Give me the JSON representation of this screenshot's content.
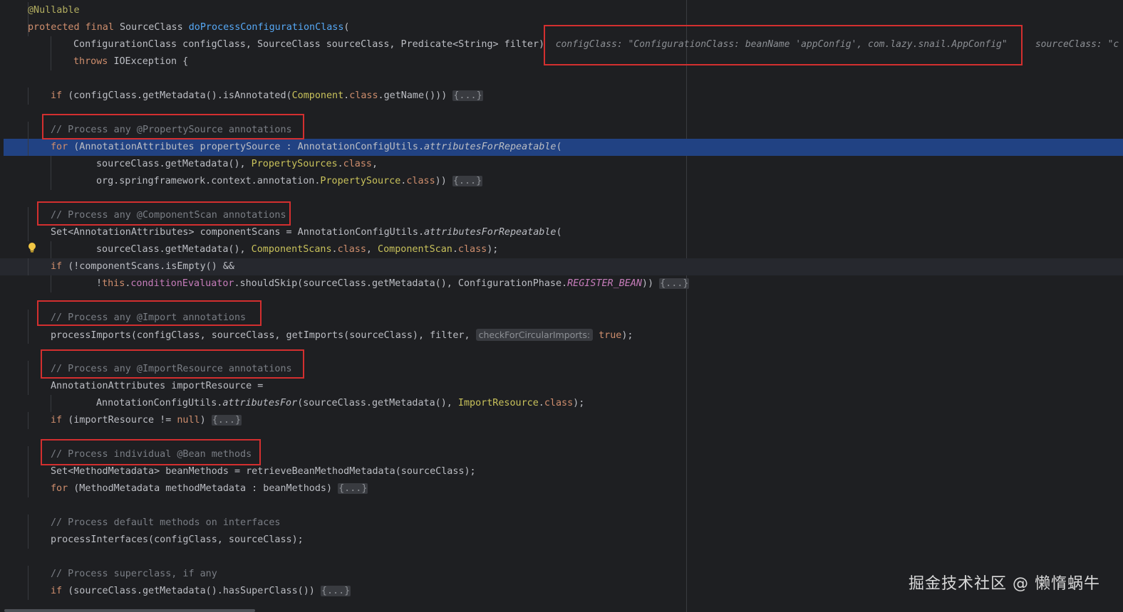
{
  "watermark": "掘金技术社区 @ 懒惰蜗牛",
  "icons": {
    "intention_bulb": "lightbulb-icon"
  },
  "colors": {
    "background": "#1e1f22",
    "keyword": "#cf8e6d",
    "method_declaration": "#56a8f5",
    "annotation": "#b3ae60",
    "class_ref": "#c9c25b",
    "comment": "#7a7e85",
    "field": "#c77dbb",
    "execution_line": "#214283",
    "highlight_box": "#d32f2f"
  },
  "lines": [
    {
      "tokens": [
        {
          "t": "@Nullable",
          "c": "ann"
        }
      ]
    },
    {
      "tokens": [
        {
          "t": "protected final ",
          "c": "kw"
        },
        {
          "t": "SourceClass ",
          "c": "plain"
        },
        {
          "t": "doProcessConfigurationClass",
          "c": "fn"
        },
        {
          "t": "(",
          "c": "plain"
        }
      ]
    },
    {
      "tokens": [
        {
          "t": "ConfigurationClass configClass, SourceClass sourceClass, Predicate<String> filter)",
          "c": "plain"
        },
        {
          "t": "  configClass: \"ConfigurationClass: beanName 'appConfig', com.lazy.snail.AppConfig\"     sourceClass: \"c",
          "c": "dbg"
        }
      ]
    },
    {
      "tokens": [
        {
          "t": "throws ",
          "c": "kw"
        },
        {
          "t": "IOException {",
          "c": "plain"
        }
      ]
    },
    {
      "tokens": []
    },
    {
      "tokens": [
        {
          "t": "if ",
          "c": "kw"
        },
        {
          "t": "(configClass.getMetadata().isAnnotated(",
          "c": "plain"
        },
        {
          "t": "Component",
          "c": "cls"
        },
        {
          "t": ".",
          "c": "plain"
        },
        {
          "t": "class",
          "c": "kw"
        },
        {
          "t": ".getName())) ",
          "c": "plain"
        },
        {
          "t": "{...}",
          "c": "fold"
        }
      ]
    },
    {
      "tokens": []
    },
    {
      "tokens": [
        {
          "t": "// Process any @PropertySource annotations",
          "c": "cmt"
        }
      ]
    },
    {
      "tokens": [
        {
          "t": "for ",
          "c": "kw"
        },
        {
          "t": "(AnnotationAttributes propertySource : AnnotationConfigUtils.",
          "c": "plain"
        },
        {
          "t": "attributesForRepeatable",
          "c": "st"
        },
        {
          "t": "(",
          "c": "plain"
        }
      ]
    },
    {
      "tokens": [
        {
          "t": "sourceClass.getMetadata(), ",
          "c": "plain"
        },
        {
          "t": "PropertySources",
          "c": "cls"
        },
        {
          "t": ".",
          "c": "plain"
        },
        {
          "t": "class",
          "c": "kw"
        },
        {
          "t": ",",
          "c": "plain"
        }
      ]
    },
    {
      "tokens": [
        {
          "t": "org.springframework.context.annotation.",
          "c": "plain"
        },
        {
          "t": "PropertySource",
          "c": "cls"
        },
        {
          "t": ".",
          "c": "plain"
        },
        {
          "t": "class",
          "c": "kw"
        },
        {
          "t": ")) ",
          "c": "plain"
        },
        {
          "t": "{...}",
          "c": "fold"
        }
      ]
    },
    {
      "tokens": []
    },
    {
      "tokens": [
        {
          "t": "// Process any @ComponentScan annotations",
          "c": "cmt"
        }
      ]
    },
    {
      "tokens": [
        {
          "t": "Set<AnnotationAttributes> componentScans = AnnotationConfigUtils.",
          "c": "plain"
        },
        {
          "t": "attributesForRepeatable",
          "c": "st"
        },
        {
          "t": "(",
          "c": "plain"
        }
      ]
    },
    {
      "tokens": [
        {
          "t": "sourceClass.getMetadata(), ",
          "c": "plain"
        },
        {
          "t": "ComponentScans",
          "c": "cls"
        },
        {
          "t": ".",
          "c": "plain"
        },
        {
          "t": "class",
          "c": "kw"
        },
        {
          "t": ", ",
          "c": "plain"
        },
        {
          "t": "ComponentScan",
          "c": "cls"
        },
        {
          "t": ".",
          "c": "plain"
        },
        {
          "t": "class",
          "c": "kw"
        },
        {
          "t": ");",
          "c": "plain"
        }
      ]
    },
    {
      "tokens": [
        {
          "t": "if ",
          "c": "kw"
        },
        {
          "t": "(!componentScans.isEmpty() &&",
          "c": "plain"
        }
      ]
    },
    {
      "tokens": [
        {
          "t": "!",
          "c": "plain"
        },
        {
          "t": "this",
          "c": "kw"
        },
        {
          "t": ".",
          "c": "plain"
        },
        {
          "t": "conditionEvaluator",
          "c": "field"
        },
        {
          "t": ".shouldSkip(sourceClass.getMetadata(), ConfigurationPhase.",
          "c": "plain"
        },
        {
          "t": "REGISTER_BEAN",
          "c": "const"
        },
        {
          "t": ")) ",
          "c": "plain"
        },
        {
          "t": "{...}",
          "c": "fold"
        }
      ]
    },
    {
      "tokens": []
    },
    {
      "tokens": [
        {
          "t": "// Process any @Import annotations",
          "c": "cmt"
        }
      ]
    },
    {
      "tokens": [
        {
          "t": "processImports(configClass, sourceClass, getImports(sourceClass), filter, ",
          "c": "plain"
        },
        {
          "t": "checkForCircularImports:",
          "c": "hint"
        },
        {
          "t": " ",
          "c": "plain"
        },
        {
          "t": "true",
          "c": "kw"
        },
        {
          "t": ");",
          "c": "plain"
        }
      ]
    },
    {
      "tokens": []
    },
    {
      "tokens": [
        {
          "t": "// Process any @ImportResource annotations",
          "c": "cmt"
        }
      ]
    },
    {
      "tokens": [
        {
          "t": "AnnotationAttributes importResource =",
          "c": "plain"
        }
      ]
    },
    {
      "tokens": [
        {
          "t": "AnnotationConfigUtils.",
          "c": "plain"
        },
        {
          "t": "attributesFor",
          "c": "st"
        },
        {
          "t": "(sourceClass.getMetadata(), ",
          "c": "plain"
        },
        {
          "t": "ImportResource",
          "c": "cls"
        },
        {
          "t": ".",
          "c": "plain"
        },
        {
          "t": "class",
          "c": "kw"
        },
        {
          "t": ");",
          "c": "plain"
        }
      ]
    },
    {
      "tokens": [
        {
          "t": "if ",
          "c": "kw"
        },
        {
          "t": "(importResource != ",
          "c": "plain"
        },
        {
          "t": "null",
          "c": "kw"
        },
        {
          "t": ") ",
          "c": "plain"
        },
        {
          "t": "{...}",
          "c": "fold"
        }
      ]
    },
    {
      "tokens": []
    },
    {
      "tokens": [
        {
          "t": "// Process individual @Bean methods",
          "c": "cmt"
        }
      ]
    },
    {
      "tokens": [
        {
          "t": "Set<MethodMetadata> beanMethods = retrieveBeanMethodMetadata(sourceClass);",
          "c": "plain"
        }
      ]
    },
    {
      "tokens": [
        {
          "t": "for ",
          "c": "kw"
        },
        {
          "t": "(MethodMetadata methodMetadata : beanMethods) ",
          "c": "plain"
        },
        {
          "t": "{...}",
          "c": "fold"
        }
      ]
    },
    {
      "tokens": []
    },
    {
      "tokens": [
        {
          "t": "// Process default methods on interfaces",
          "c": "cmt"
        }
      ]
    },
    {
      "tokens": [
        {
          "t": "processInterfaces(configClass, sourceClass);",
          "c": "plain"
        }
      ]
    },
    {
      "tokens": []
    },
    {
      "tokens": [
        {
          "t": "// Process superclass, if any",
          "c": "cmt"
        }
      ]
    },
    {
      "tokens": [
        {
          "t": "if ",
          "c": "kw"
        },
        {
          "t": "(sourceClass.getMetadata().hasSuperClass()) ",
          "c": "plain"
        },
        {
          "t": "{...}",
          "c": "fold"
        }
      ]
    }
  ]
}
